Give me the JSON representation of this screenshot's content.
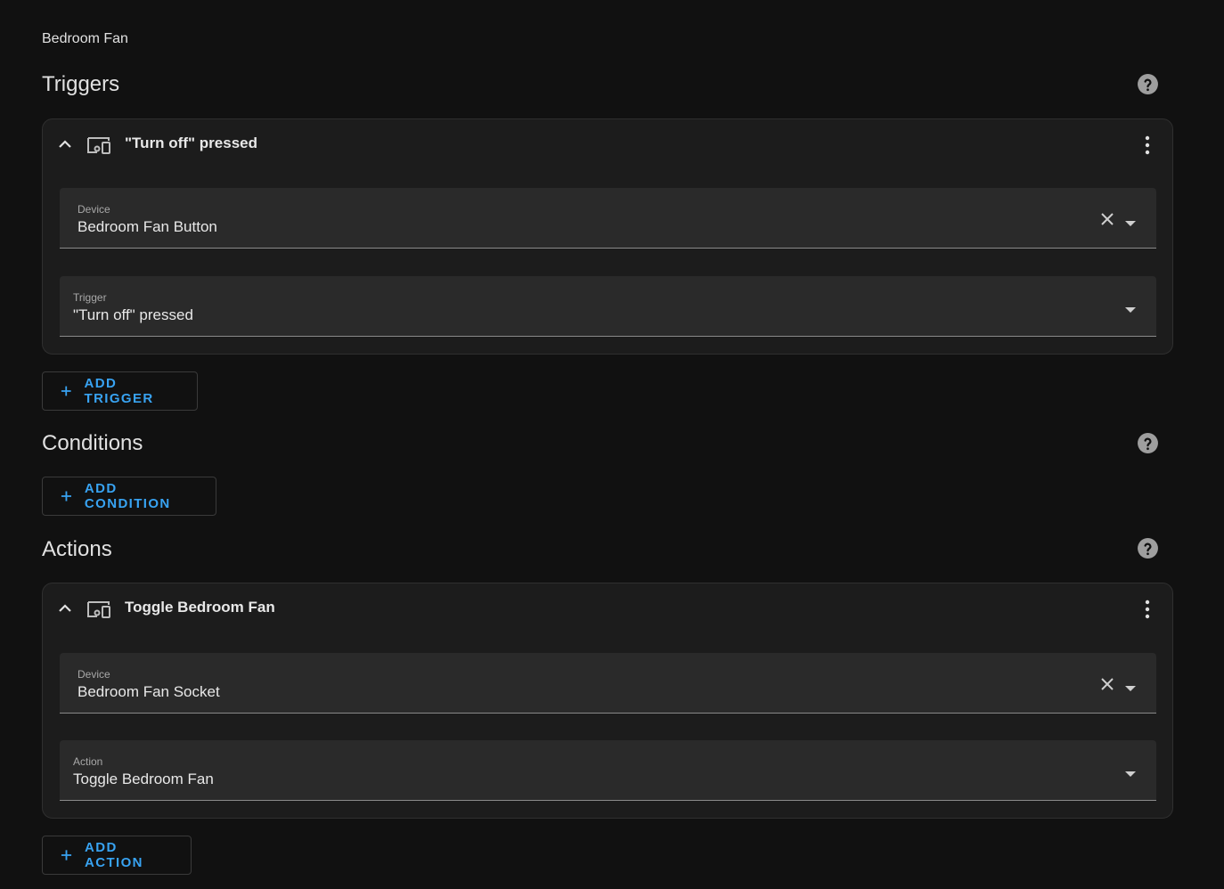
{
  "automation": {
    "name": "Bedroom Fan"
  },
  "triggers": {
    "title": "Triggers",
    "items": [
      {
        "title": "\"Turn off\" pressed",
        "device_field": {
          "label": "Device",
          "value": "Bedroom Fan Button"
        },
        "trigger_field": {
          "label": "Trigger",
          "value": "\"Turn off\" pressed"
        }
      }
    ],
    "add_label": "ADD TRIGGER"
  },
  "conditions": {
    "title": "Conditions",
    "add_label": "ADD CONDITION"
  },
  "actions": {
    "title": "Actions",
    "items": [
      {
        "title": "Toggle Bedroom Fan",
        "device_field": {
          "label": "Device",
          "value": "Bedroom Fan Socket"
        },
        "action_field": {
          "label": "Action",
          "value": "Toggle Bedroom Fan"
        }
      }
    ],
    "add_label": "ADD ACTION"
  },
  "colors": {
    "background": "#111111",
    "card": "#1c1c1c",
    "field": "#2a2a2a",
    "accent": "#38a3f2",
    "help_icon": "#9e9e9e"
  },
  "icons": {
    "help": "help-circle-icon",
    "collapse": "chevron-up-icon",
    "device": "devices-icon",
    "menu": "dots-vertical-icon",
    "clear": "close-icon",
    "dropdown": "menu-down-icon",
    "add": "plus-icon"
  }
}
